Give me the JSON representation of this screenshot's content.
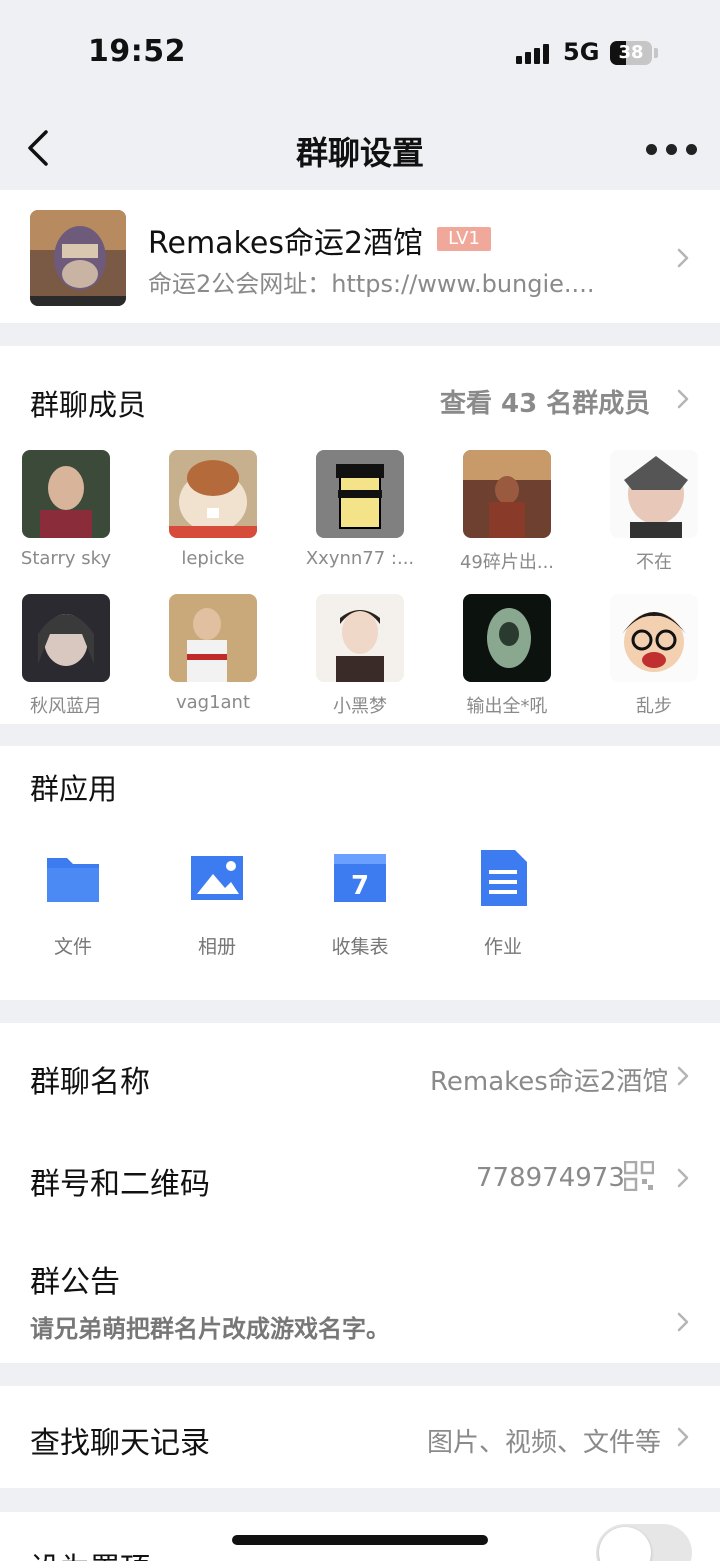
{
  "status_bar": {
    "time": "19:52",
    "network": "5G",
    "battery": "38"
  },
  "nav": {
    "title": "群聊设置"
  },
  "group": {
    "name": "Remakes命运2酒馆",
    "level": "LV1",
    "description": "命运2公会网址：https://www.bungie...."
  },
  "members": {
    "title": "群聊成员",
    "view_all": "查看 43 名群成员",
    "list": [
      {
        "name": "Starry sky"
      },
      {
        "name": "lepicke"
      },
      {
        "name": "Xxynn77 :..."
      },
      {
        "name": "49碎片出..."
      },
      {
        "name": "不在"
      },
      {
        "name": "秋风蓝月"
      },
      {
        "name": "vag1ant"
      },
      {
        "name": "小黑梦"
      },
      {
        "name": "输出全*吼"
      },
      {
        "name": "乱步"
      }
    ]
  },
  "apps": {
    "title": "群应用",
    "items": [
      {
        "label": "文件",
        "icon": "folder-icon"
      },
      {
        "label": "相册",
        "icon": "photo-album-icon"
      },
      {
        "label": "收集表",
        "icon": "calendar-form-icon"
      },
      {
        "label": "作业",
        "icon": "document-icon"
      }
    ],
    "calendar_num": "7"
  },
  "settings": {
    "group_name_label": "群聊名称",
    "group_name_value": "Remakes命运2酒馆",
    "group_id_label": "群号和二维码",
    "group_id_value": "778974973",
    "notice_label": "群公告",
    "notice_text": "请兄弟萌把群名片改成游戏名字。",
    "search_label": "查找聊天记录",
    "search_hint": "图片、视频、文件等",
    "pin_label": "设为置顶"
  },
  "colors": {
    "accent_blue": "#3d7cf0",
    "level_badge": "#f0a89a",
    "background": "#eef0f4"
  }
}
